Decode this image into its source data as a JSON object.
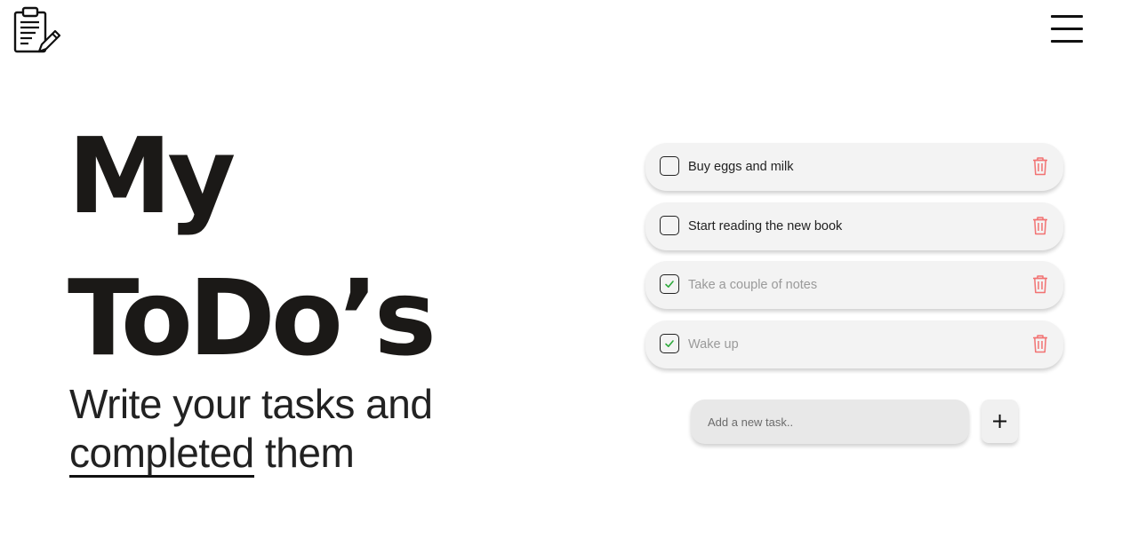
{
  "header": {
    "logo_icon": "clipboard-pencil-icon",
    "menu_icon": "hamburger-menu-icon"
  },
  "hero": {
    "title_line1": "My",
    "title_line2": "ToDo’s",
    "subtitle_line1": "Write your tasks and",
    "subtitle_underlined": "completed",
    "subtitle_rest": " them"
  },
  "tasks": [
    {
      "text": "Buy eggs and milk",
      "completed": false
    },
    {
      "text": "Start reading the new book",
      "completed": false
    },
    {
      "text": "Take a couple of notes",
      "completed": true
    },
    {
      "text": "Wake up",
      "completed": true
    }
  ],
  "add_task": {
    "placeholder": "Add a new task..",
    "button_label": "+"
  },
  "colors": {
    "check": "#2eaa3c",
    "delete": "#f27272",
    "card": "#f3f3f3",
    "text": "#1b1917"
  }
}
